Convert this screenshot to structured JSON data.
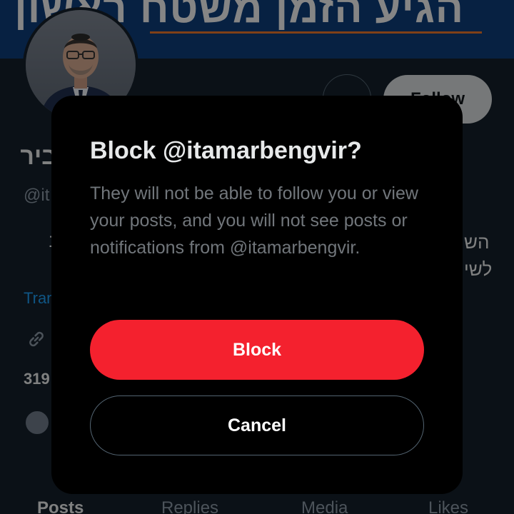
{
  "profile": {
    "banner_text": "הגיע הזמן משטח ראשון",
    "follow_label": "Follow",
    "name": "ביר",
    "handle": "@it",
    "bio_left": "ב",
    "bio_right_line1": "הש",
    "bio_right_line2": "לשי",
    "translate_label": "Tran",
    "count": "319",
    "tabs": [
      {
        "label": "Posts"
      },
      {
        "label": "Replies"
      },
      {
        "label": "Media"
      },
      {
        "label": "Likes"
      }
    ]
  },
  "modal": {
    "title": "Block @itamarbengvir?",
    "description": "They will not be able to follow you or view your posts, and you will not see posts or notifications from @itamarbengvir.",
    "block_label": "Block",
    "cancel_label": "Cancel"
  },
  "colors": {
    "background": "#15202b",
    "modal_bg": "#000000",
    "block_button": "#f4212e",
    "link": "#1d9bf0",
    "secondary_text": "#71767b"
  }
}
